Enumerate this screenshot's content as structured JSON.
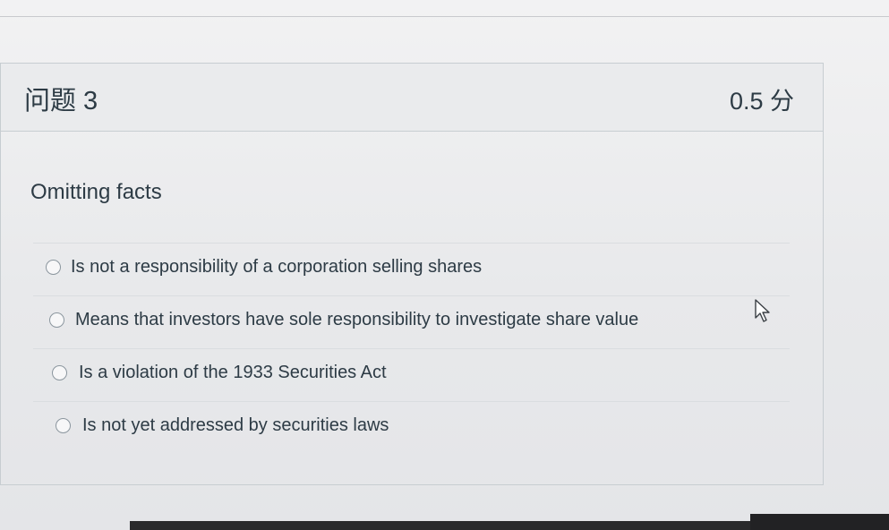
{
  "question": {
    "title": "问题 3",
    "points": "0.5 分",
    "text": "Omitting facts"
  },
  "answers": [
    {
      "label": "Is not a responsibility of a corporation selling shares",
      "selected": false
    },
    {
      "label": "Means that investors have sole responsibility to investigate share value",
      "selected": false
    },
    {
      "label": "Is a violation of the 1933 Securities Act",
      "selected": false
    },
    {
      "label": "Is not yet addressed by securities laws",
      "selected": false
    }
  ],
  "icons": {
    "cursor": "mouse-pointer-icon"
  },
  "colors": {
    "text": "#2d3b45",
    "border": "#c7cdd1"
  }
}
